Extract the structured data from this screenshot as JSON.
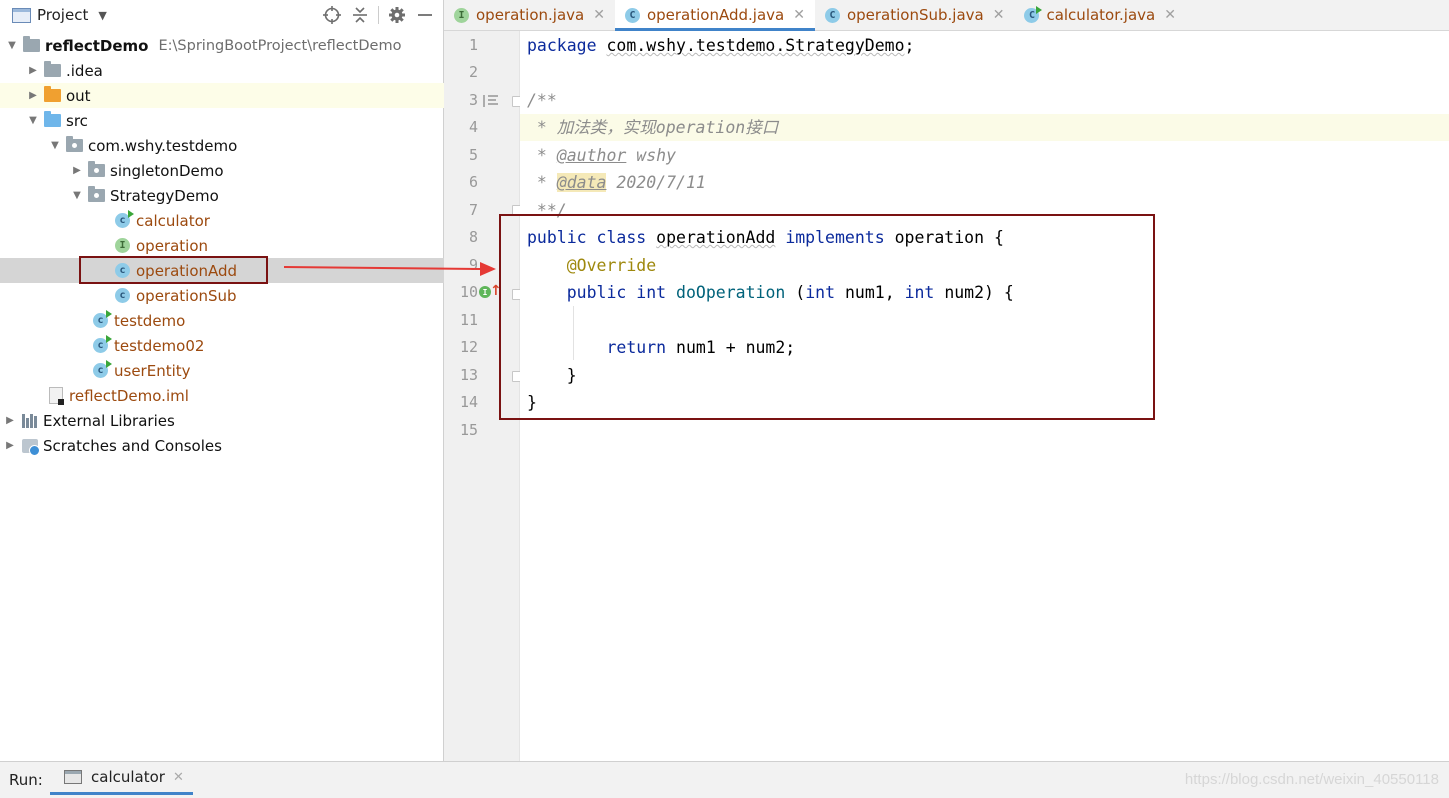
{
  "project_panel": {
    "title": "Project",
    "tree": [
      {
        "label": "reflectDemo",
        "path": "E:\\SpringBootProject\\reflectDemo"
      },
      {
        "label": ".idea"
      },
      {
        "label": "out"
      },
      {
        "label": "src"
      },
      {
        "label": "com.wshy.testdemo"
      },
      {
        "label": "singletonDemo"
      },
      {
        "label": "StrategyDemo"
      },
      {
        "label": "calculator"
      },
      {
        "label": "operation"
      },
      {
        "label": "operationAdd"
      },
      {
        "label": "operationSub"
      },
      {
        "label": "testdemo"
      },
      {
        "label": "testdemo02"
      },
      {
        "label": "userEntity"
      },
      {
        "label": "reflectDemo.iml"
      },
      {
        "label": "External Libraries"
      },
      {
        "label": "Scratches and Consoles"
      }
    ]
  },
  "editor": {
    "tabs": [
      {
        "label": "operation.java",
        "badge": "I"
      },
      {
        "label": "operationAdd.java",
        "badge": "C"
      },
      {
        "label": "operationSub.java",
        "badge": "C"
      },
      {
        "label": "calculator.java",
        "badge": "C"
      }
    ],
    "line_numbers": [
      "1",
      "2",
      "3",
      "4",
      "5",
      "6",
      "7",
      "8",
      "9",
      "10",
      "11",
      "12",
      "13",
      "14",
      "15"
    ],
    "code": {
      "l1_kw": "package",
      "l1_pkg": "com.wshy.testdemo.StrategyDemo",
      "l1_end": ";",
      "l3": "/**",
      "l4": " * 加法类，实现operation接口",
      "l5_pre": " * ",
      "l5_tag": "@author",
      "l5_val": " wshy",
      "l6_pre": " * ",
      "l6_tag": "@data",
      "l6_val": " 2020/7/11",
      "l7": " **/",
      "l8_kw1": "public",
      "l8_kw2": "class",
      "l8_cls": "operationAdd",
      "l8_kw3": "implements",
      "l8_iface": "operation",
      "l8_brace": "{",
      "l9_ann": "@Override",
      "l10_kw1": "public",
      "l10_kw2": "int",
      "l10_meth": "doOperation",
      "l10_p1": "(",
      "l10_kw3": "int",
      "l10_a1": "num1,",
      "l10_kw4": "int",
      "l10_a2": "num2)",
      "l10_brace": "{",
      "l12_kw": "return",
      "l12_expr": "num1 + num2;",
      "l13": "}",
      "l14": "}"
    }
  },
  "run_bar": {
    "label": "Run:",
    "tab": "calculator"
  },
  "watermark": "https://blog.csdn.net/weixin_40550118",
  "colors": {
    "keyword": "#0b2a9c",
    "annotation": "#9e880d",
    "method": "#00627a",
    "comment": "#8c8c8c",
    "tree_file": "#9c4a0f",
    "highlight_box": "#7a1212",
    "arrow": "#e53935",
    "tab_underline": "#4083c9"
  }
}
